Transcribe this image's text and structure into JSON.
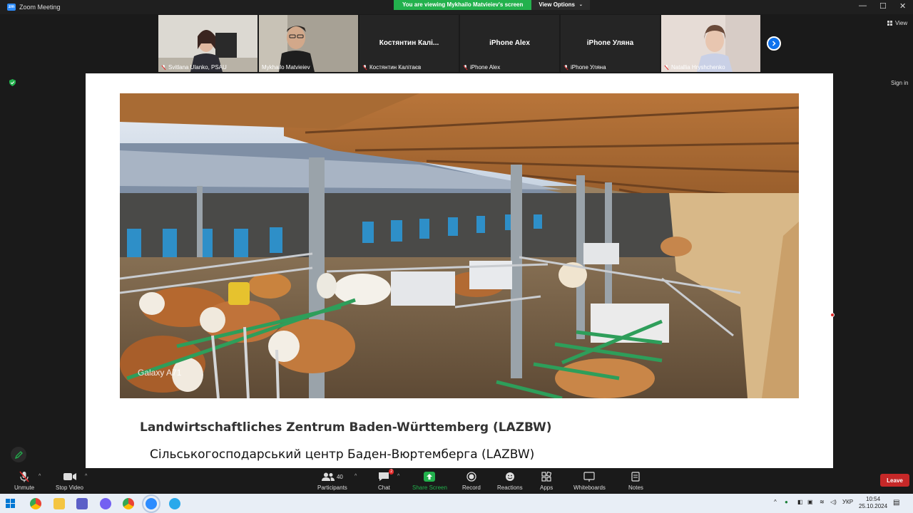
{
  "window": {
    "title": "Zoom Meeting"
  },
  "share_banner": {
    "text": "You are viewing Mykhailo Matvieiev's screen",
    "view_options": "View Options"
  },
  "side": {
    "view_label": "View",
    "signin_label": "Sign in"
  },
  "participants": [
    {
      "name": "Svitlana Ulanko, PSAU",
      "video": true,
      "muted": true
    },
    {
      "name": "Mykhailo Matvieiev",
      "video": true,
      "muted": false
    },
    {
      "name": "Костянтин Калітаєв",
      "display": "Костянтин  Калі...",
      "video": false,
      "muted": true
    },
    {
      "name": "iPhone Alex",
      "display": "iPhone Alex",
      "video": false,
      "muted": true
    },
    {
      "name": "iPhone Уляна",
      "display": "iPhone Уляна",
      "video": false,
      "muted": true
    },
    {
      "name": "Natallia Hryshchenko",
      "video": true,
      "muted": true
    }
  ],
  "slide": {
    "title_de": "Landwirtschaftliches Zentrum Baden-Württemberg (LAZBW)",
    "title_uk": "Сільськогосподарський центр Баден-Вюртемберга (LAZBW)",
    "photo_watermark": "Galaxy A71"
  },
  "toolbar": {
    "unmute": "Unmute",
    "stop_video": "Stop Video",
    "participants": "Participants",
    "participants_count": "40",
    "chat": "Chat",
    "chat_badge": "2",
    "share_screen": "Share Screen",
    "record": "Record",
    "reactions": "Reactions",
    "apps": "Apps",
    "whiteboards": "Whiteboards",
    "notes": "Notes",
    "leave": "Leave"
  },
  "taskbar": {
    "apps": [
      "chrome-icon",
      "file-explorer-icon",
      "teams-icon",
      "viber-icon",
      "chrome-profile-icon",
      "zoom-icon",
      "telegram-icon"
    ],
    "lang": "УКР",
    "time": "10:54",
    "date": "25.10.2024"
  },
  "colors": {
    "share_green": "#23b14d",
    "accent_blue": "#0e72ed",
    "leave_red": "#c62828"
  }
}
